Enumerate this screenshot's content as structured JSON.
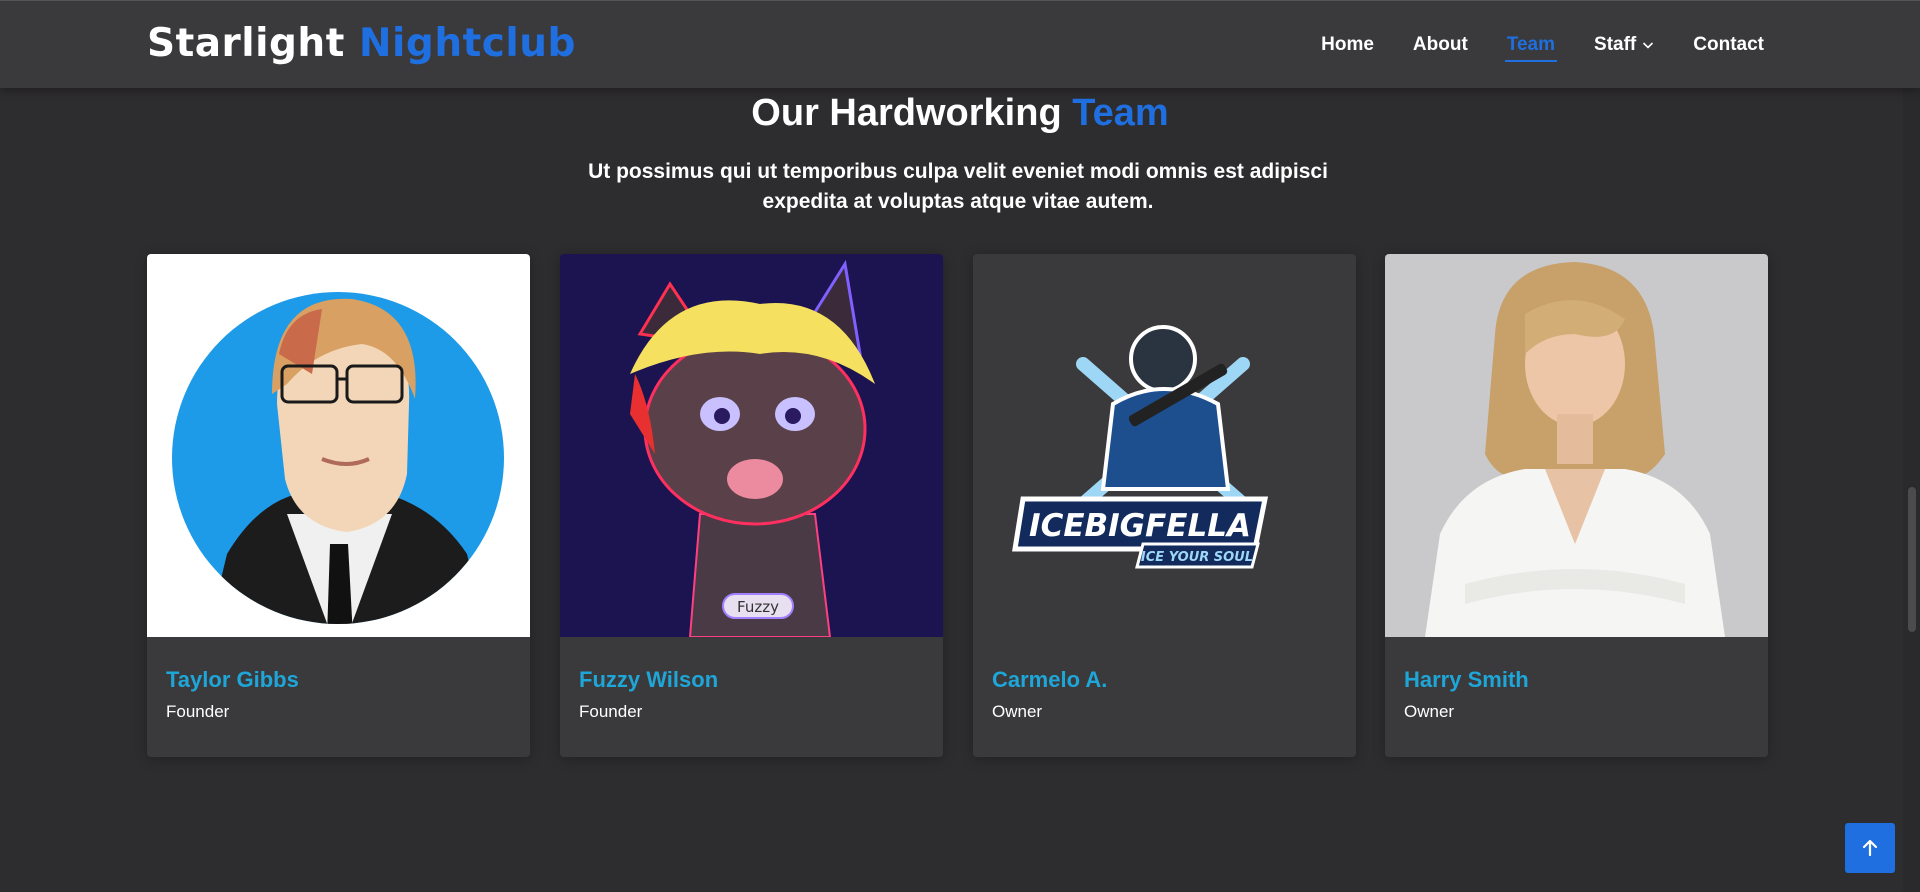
{
  "header": {
    "logo_main": "Starlight",
    "logo_accent": "Nightclub",
    "nav": [
      {
        "label": "Home"
      },
      {
        "label": "About"
      },
      {
        "label": "Team"
      },
      {
        "label": "Staff"
      },
      {
        "label": "Contact"
      }
    ],
    "active_nav": "Team"
  },
  "section": {
    "title_main": "Our Hardworking",
    "title_accent": "Team",
    "description": "Ut possimus qui ut temporibus culpa velit eveniet modi omnis est adipisci expedita at voluptas atque vitae autem."
  },
  "team": [
    {
      "name": "Taylor Gibbs",
      "role": "Founder"
    },
    {
      "name": "Fuzzy Wilson",
      "role": "Founder"
    },
    {
      "name": "Carmelo A.",
      "role": "Owner"
    },
    {
      "name": "Harry Smith",
      "role": "Owner"
    }
  ],
  "images": {
    "fuzzy_tag": "Fuzzy",
    "ice_logo_title": "ICEBIGFELLA",
    "ice_logo_subtitle": "ICE YOUR SOUL"
  },
  "colors": {
    "accent": "#1f6fe0",
    "name_color": "#1ea6d8",
    "background": "#2d2c2e",
    "header_bg": "#3a393b",
    "card_bg": "#3a393b"
  },
  "icons": {
    "back_to_top": "arrow-up-icon",
    "staff_dropdown": "chevron-down-icon"
  }
}
